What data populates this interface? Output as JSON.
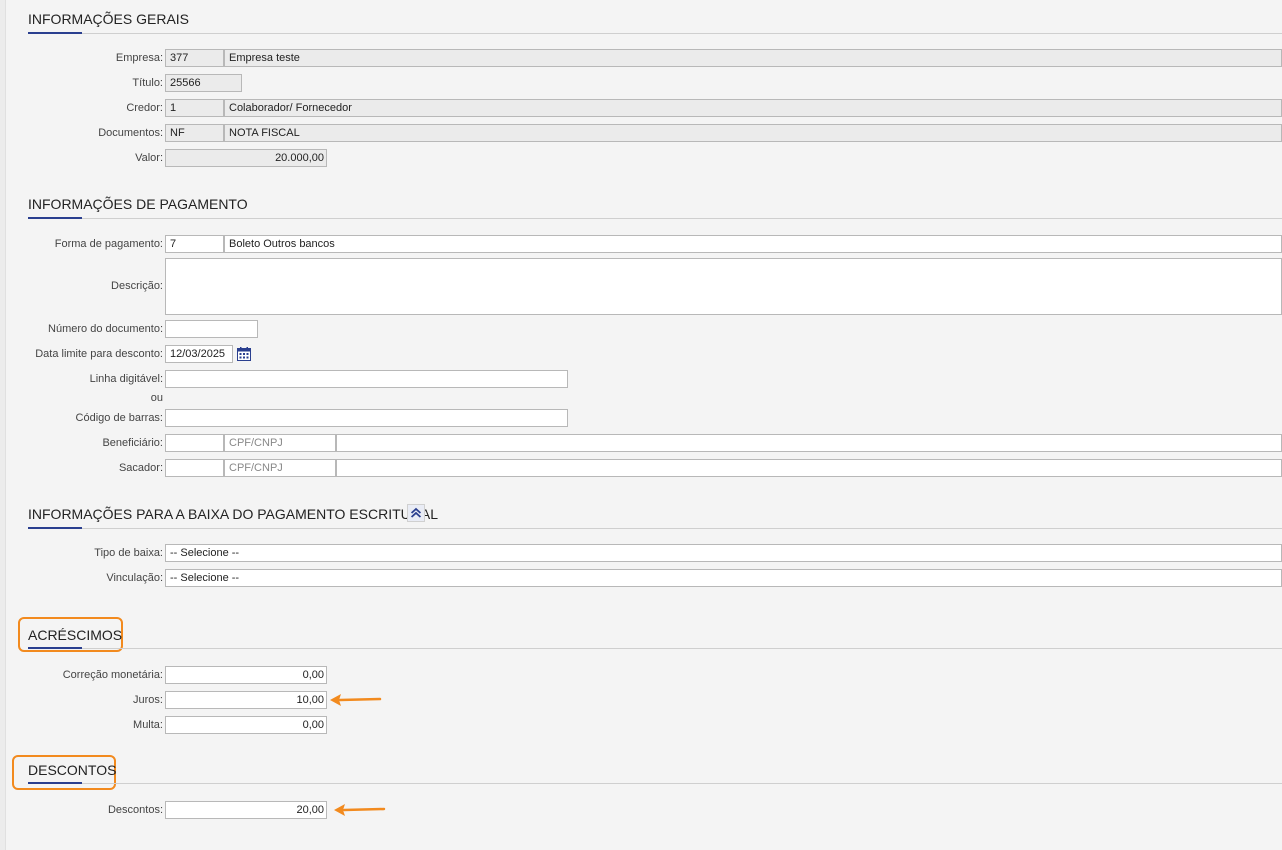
{
  "sections": {
    "gerais": "INFORMAÇÕES GERAIS",
    "pagamento": "INFORMAÇÕES DE PAGAMENTO",
    "baixa": "INFORMAÇÕES PARA A BAIXA DO PAGAMENTO ESCRITURAL",
    "acrescimos": "ACRÉSCIMOS",
    "descontos": "DESCONTOS"
  },
  "gerais": {
    "empresa": {
      "label": "Empresa:",
      "code": "377",
      "name": "Empresa teste"
    },
    "titulo": {
      "label": "Título:",
      "value": "25566"
    },
    "credor": {
      "label": "Credor:",
      "code": "1",
      "name": "Colaborador/ Fornecedor"
    },
    "documentos": {
      "label": "Documentos:",
      "code": "NF",
      "name": "NOTA FISCAL"
    },
    "valor": {
      "label": "Valor:",
      "value": "20.000,00"
    }
  },
  "pagamento": {
    "forma": {
      "label": "Forma de pagamento:",
      "code": "7",
      "name": "Boleto Outros bancos"
    },
    "descricao": {
      "label": "Descrição:",
      "value": ""
    },
    "numero_documento": {
      "label": "Número do documento:",
      "value": ""
    },
    "data_limite": {
      "label": "Data limite para desconto:",
      "value": "12/03/2025",
      "icon": "calendar-icon"
    },
    "linha_digitavel": {
      "label": "Linha digitável:",
      "value": ""
    },
    "ou": "ou",
    "codigo_barras": {
      "label": "Código de barras:",
      "value": ""
    },
    "beneficiario": {
      "label": "Beneficiário:",
      "code": "",
      "doc_placeholder": "CPF/CNPJ",
      "name": ""
    },
    "sacador": {
      "label": "Sacador:",
      "code": "",
      "doc_placeholder": "CPF/CNPJ",
      "name": ""
    }
  },
  "baixa": {
    "collapse_icon": "double-chevron-up-icon",
    "tipo": {
      "label": "Tipo de baixa:",
      "value": "-- Selecione --"
    },
    "vinculacao": {
      "label": "Vinculação:",
      "value": "-- Selecione --"
    }
  },
  "acrescimos": {
    "correcao": {
      "label": "Correção monetária:",
      "value": "0,00"
    },
    "juros": {
      "label": "Juros:",
      "value": "10,00"
    },
    "multa": {
      "label": "Multa:",
      "value": "0,00"
    }
  },
  "descontos": {
    "descontos": {
      "label": "Descontos:",
      "value": "20,00"
    }
  },
  "colors": {
    "accent": "#2a3f8f",
    "highlight": "#f28a1e"
  }
}
